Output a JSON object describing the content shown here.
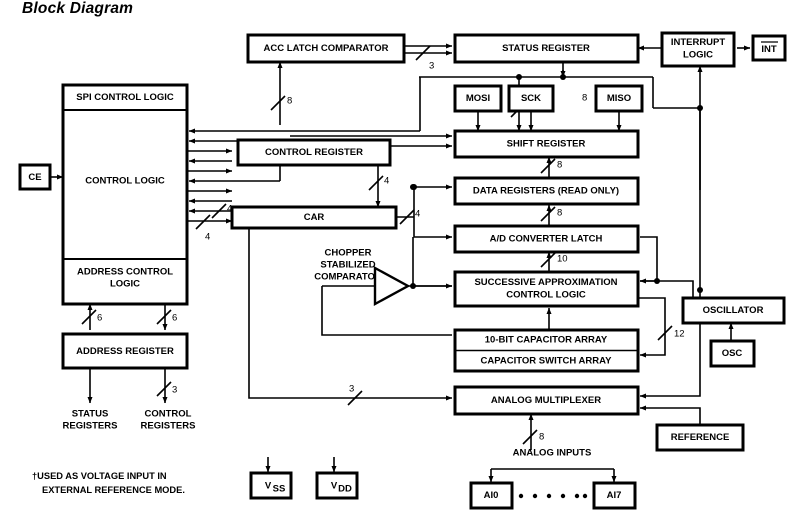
{
  "title": "Block Diagram",
  "footnote": {
    "line1": "†USED AS VOLTAGE INPUT IN",
    "line2": "EXTERNAL REFERENCE MODE."
  },
  "blocks": {
    "ce": "CE",
    "spi_control_logic": "SPI CONTROL LOGIC",
    "control_logic": "CONTROL LOGIC",
    "address_control_logic_1": "ADDRESS CONTROL",
    "address_control_logic_2": "LOGIC",
    "address_register": "ADDRESS REGISTER",
    "control_register": "CONTROL REGISTER",
    "car": "CAR",
    "acc_latch_comparator": "ACC LATCH COMPARATOR",
    "status_register": "STATUS REGISTER",
    "interrupt_logic_1": "INTERRUPT",
    "interrupt_logic_2": "LOGIC",
    "int": "INT",
    "mosi": "MOSI",
    "sck": "SCK",
    "miso": "MISO",
    "shift_register": "SHIFT REGISTER",
    "data_registers": "DATA REGISTERS (READ ONLY)",
    "ad_converter_latch": "A/D CONVERTER LATCH",
    "successive_approx_1": "SUCCESSIVE APPROXIMATION",
    "successive_approx_2": "CONTROL LOGIC",
    "capacitor_array": "10-BIT CAPACITOR ARRAY",
    "capacitor_switch_array": "CAPACITOR SWITCH ARRAY",
    "analog_multiplexer": "ANALOG MULTIPLEXER",
    "oscillator": "OSCILLATOR",
    "osc": "OSC",
    "reference": "REFERENCE",
    "ai0": "AI0",
    "ai7": "AI7",
    "vss_main": "V",
    "vss_sub": "SS",
    "vdd_main": "V",
    "vdd_sub": "DD"
  },
  "labels": {
    "chopper_1": "CHOPPER",
    "chopper_2": "STABILIZED",
    "chopper_3": "COMPARATOR",
    "status_registers_1": "STATUS",
    "status_registers_2": "REGISTERS",
    "control_registers_1": "CONTROL",
    "control_registers_2": "REGISTERS",
    "analog_inputs": "ANALOG INPUTS",
    "ellipsis_dots": 7
  },
  "bus_widths": {
    "acc_to_status": "8",
    "status_in": "3",
    "ctrl_reg_to_car": "4",
    "car_in_4": "4",
    "car_out_4": "4",
    "shift_in_8": "8",
    "shift_from_data_8": "8",
    "data_from_adc_8": "8",
    "adc_from_sar_10": "10",
    "sar_to_capsw_12": "12",
    "addr_up_6": "6",
    "addr_down_6": "6",
    "addr_reg_3": "3",
    "car_to_mux_3": "3",
    "mux_in_8": "8"
  },
  "colors": {
    "stroke": "#000000",
    "fill": "#ffffff",
    "background": "#ffffff"
  }
}
